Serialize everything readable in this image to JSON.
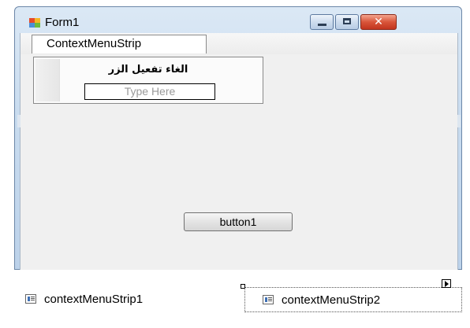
{
  "window": {
    "title": "Form1"
  },
  "menustrip": {
    "tab_label": "ContextMenuStrip",
    "items": [
      {
        "label": "الغاء تفعيل الزر"
      }
    ],
    "type_here_placeholder": "Type Here"
  },
  "form": {
    "button1_label": "button1"
  },
  "tray": {
    "items": [
      {
        "label": "contextMenuStrip1",
        "icon": "context-menu-icon"
      },
      {
        "label": "contextMenuStrip2",
        "icon": "context-menu-icon"
      }
    ]
  },
  "colors": {
    "frame": "#c9dcef",
    "client": "#f0f0f0",
    "close_button": "#d8553a"
  }
}
